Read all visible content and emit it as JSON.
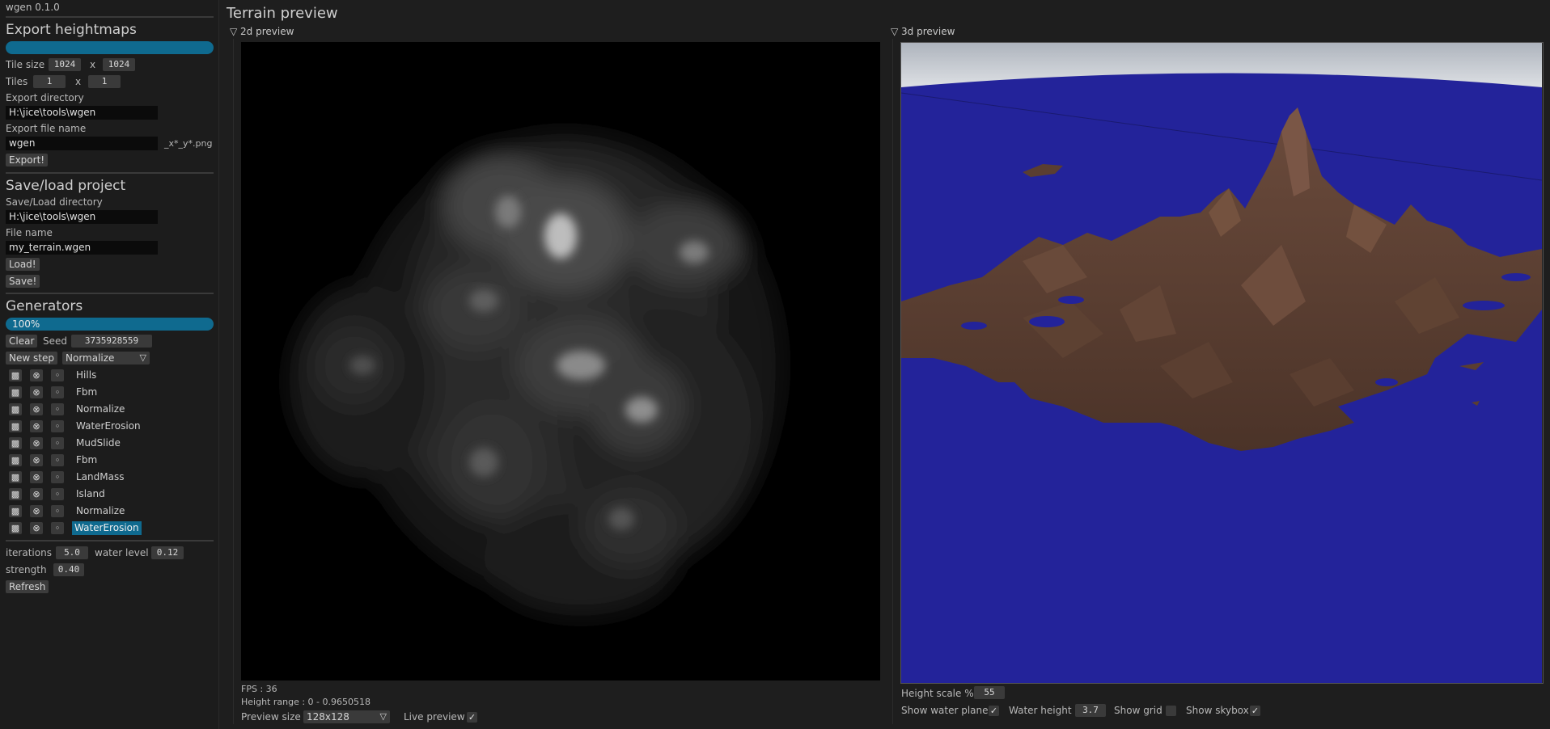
{
  "app_title": "wgen 0.1.0",
  "export": {
    "heading": "Export heightmaps",
    "tile_size_label": "Tile size",
    "tile_w": "1024",
    "tile_h": "1024",
    "x_sep": "x",
    "tiles_label": "Tiles",
    "tiles_x": "1",
    "tiles_y": "1",
    "dir_label": "Export directory",
    "dir_value": "H:\\jice\\tools\\wgen",
    "file_label": "Export file name",
    "file_value": "wgen",
    "file_suffix": "_x*_y*.png",
    "export_button": "Export!"
  },
  "project": {
    "heading": "Save/load project",
    "dir_label": "Save/Load directory",
    "dir_value": "H:\\jice\\tools\\wgen",
    "file_label": "File name",
    "file_value": "my_terrain.wgen",
    "load_button": "Load!",
    "save_button": "Save!"
  },
  "generators": {
    "heading": "Generators",
    "progress_text": "100%",
    "progress": 1.0,
    "clear_button": "Clear",
    "seed_label": "Seed",
    "seed_value": "3735928559",
    "new_step_button": "New step",
    "step_type": "Normalize",
    "steps": [
      {
        "name": "Hills"
      },
      {
        "name": "Fbm"
      },
      {
        "name": "Normalize"
      },
      {
        "name": "WaterErosion"
      },
      {
        "name": "MudSlide"
      },
      {
        "name": "Fbm"
      },
      {
        "name": "LandMass"
      },
      {
        "name": "Island"
      },
      {
        "name": "Normalize"
      },
      {
        "name": "WaterErosion",
        "selected": true
      }
    ],
    "iterations_label": "iterations",
    "iterations_value": "5.0",
    "water_level_label": "water level",
    "water_level_value": "0.12",
    "strength_label": "strength",
    "strength_value": "0.40",
    "refresh_button": "Refresh"
  },
  "preview": {
    "title": "Terrain preview",
    "view2d_title": "2d preview",
    "view3d_title": "3d preview",
    "fps": "FPS : 36",
    "height_range": "Height range : 0 - 0.9650518",
    "preview_size_label": "Preview size",
    "preview_size_value": "128x128",
    "live_preview_label": "Live preview",
    "live_preview_checked": true,
    "height_scale_label": "Height scale %",
    "height_scale_value": "55",
    "show_water_plane_label": "Show water plane",
    "show_water_plane": true,
    "water_height_label": "Water height",
    "water_height_value": "3.7",
    "show_grid_label": "Show grid",
    "show_grid": false,
    "show_skybox_label": "Show skybox",
    "show_skybox": true
  },
  "colors": {
    "accent": "#0f6a8f",
    "water": "#23239a",
    "terrain": "#5a3e31",
    "sky": "#c9ced6"
  },
  "icons": [
    "texture-icon",
    "delete-icon",
    "eye-icon",
    "chevron-down-icon",
    "collapse-triangle-icon",
    "check-icon"
  ]
}
